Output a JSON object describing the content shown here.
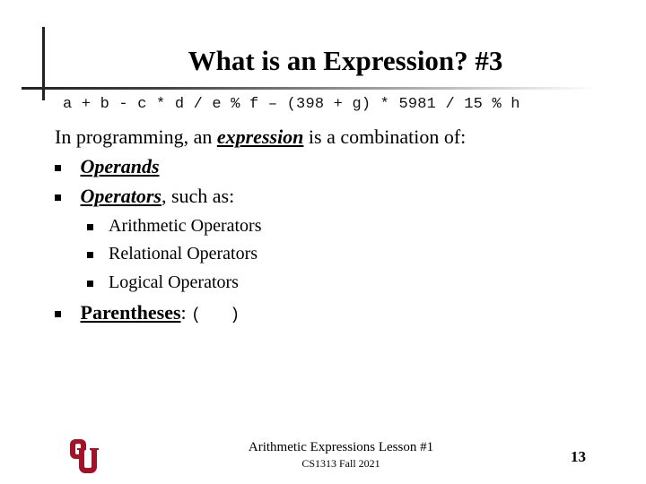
{
  "slide": {
    "title": "What is an Expression? #3",
    "code_line": "a + b - c * d / e % f – (398 + g) * 5981 / 15 % h",
    "intro": {
      "before": "In programming, an ",
      "emphasis": "expression",
      "after": " is a combination of:"
    },
    "bullets": [
      {
        "label": "Operands",
        "suffix": ""
      },
      {
        "label": "Operators",
        "suffix": ", such as:"
      }
    ],
    "sub_bullets": [
      "Arithmetic Operators",
      "Relational Operators",
      "Logical Operators"
    ],
    "last_bullet": {
      "label": "Parentheses",
      "suffix": ": ",
      "code": "(   )"
    }
  },
  "footer": {
    "line1": "Arithmetic Expressions Lesson #1",
    "line2": "CS1313 Fall 2021",
    "page_number": "13",
    "logo": "ou-logo-icon",
    "logo_color": "#A0142A"
  }
}
